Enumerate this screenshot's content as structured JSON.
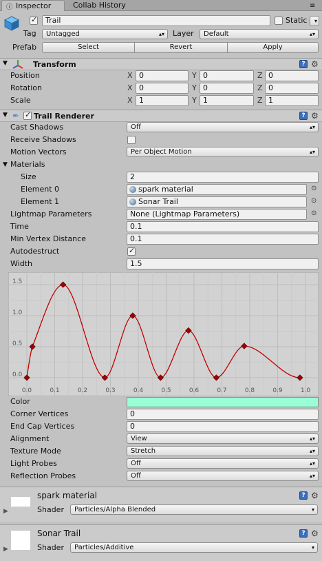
{
  "tabs": [
    {
      "label": "Inspector"
    },
    {
      "label": "Collab History"
    }
  ],
  "object": {
    "name": "Trail",
    "static_label": "Static",
    "tag_label": "Tag",
    "tag_value": "Untagged",
    "layer_label": "Layer",
    "layer_value": "Default",
    "prefab_label": "Prefab",
    "prefab_buttons": [
      "Select",
      "Revert",
      "Apply"
    ]
  },
  "transform": {
    "title": "Transform",
    "rows": [
      {
        "label": "Position",
        "x": "0",
        "y": "0",
        "z": "0"
      },
      {
        "label": "Rotation",
        "x": "0",
        "y": "0",
        "z": "0"
      },
      {
        "label": "Scale",
        "x": "1",
        "y": "1",
        "z": "1"
      }
    ],
    "axis": [
      "X",
      "Y",
      "Z"
    ]
  },
  "trail": {
    "title": "Trail Renderer",
    "cast_shadows": {
      "label": "Cast Shadows",
      "value": "Off"
    },
    "receive_shadows": {
      "label": "Receive Shadows"
    },
    "motion_vectors": {
      "label": "Motion Vectors",
      "value": "Per Object Motion"
    },
    "materials": {
      "label": "Materials",
      "size_label": "Size",
      "size": "2",
      "elements": [
        {
          "label": "Element 0",
          "value": "spark material"
        },
        {
          "label": "Element 1",
          "value": "Sonar Trail"
        }
      ]
    },
    "lightmap": {
      "label": "Lightmap Parameters",
      "value": "None (Lightmap Parameters)"
    },
    "time": {
      "label": "Time",
      "value": "0.1"
    },
    "min_vertex": {
      "label": "Min Vertex Distance",
      "value": "0.1"
    },
    "autodestruct": {
      "label": "Autodestruct"
    },
    "width": {
      "label": "Width",
      "value": "1.5"
    },
    "color": {
      "label": "Color",
      "swatch": "#9affd6"
    },
    "corner": {
      "label": "Corner Vertices",
      "value": "0"
    },
    "endcap": {
      "label": "End Cap Vertices",
      "value": "0"
    },
    "alignment": {
      "label": "Alignment",
      "value": "View"
    },
    "texture_mode": {
      "label": "Texture Mode",
      "value": "Stretch"
    },
    "light_probes": {
      "label": "Light Probes",
      "value": "Off"
    },
    "reflection_probes": {
      "label": "Reflection Probes",
      "value": "Off"
    }
  },
  "materials_panels": [
    {
      "name": "spark material",
      "shader_label": "Shader",
      "shader": "Particles/Alpha Blended"
    },
    {
      "name": "Sonar Trail",
      "shader_label": "Shader",
      "shader": "Particles/Additive"
    }
  ],
  "chart_data": {
    "type": "line",
    "x_ticks": [
      "0.0",
      "0.1",
      "0.2",
      "0.3",
      "0.4",
      "0.5",
      "0.6",
      "0.7",
      "0.8",
      "0.9",
      "1.0"
    ],
    "y_ticks": [
      "0.0",
      "0.5",
      "1.0",
      "1.5"
    ],
    "xlim": [
      0,
      1
    ],
    "ylim": [
      0,
      1.5
    ],
    "keys": [
      {
        "x": 0.0,
        "y": 0.0
      },
      {
        "x": 0.02,
        "y": 0.5
      },
      {
        "x": 0.13,
        "y": 1.5
      },
      {
        "x": 0.28,
        "y": 0.0
      },
      {
        "x": 0.38,
        "y": 1.0
      },
      {
        "x": 0.48,
        "y": 0.0
      },
      {
        "x": 0.58,
        "y": 0.76
      },
      {
        "x": 0.68,
        "y": 0.0
      },
      {
        "x": 0.78,
        "y": 0.51
      },
      {
        "x": 0.98,
        "y": 0.0
      }
    ],
    "line_color": "#c00000",
    "grid": true
  }
}
